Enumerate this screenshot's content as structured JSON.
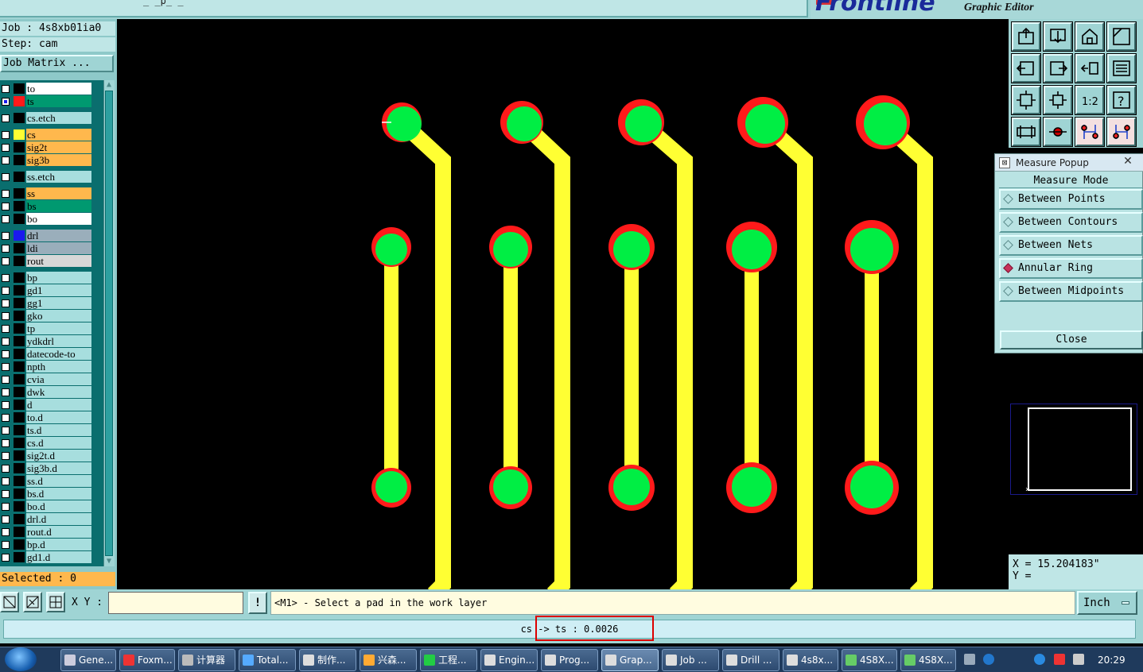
{
  "app": {
    "brand": "Frontline",
    "subtitle": "Graphic Editor",
    "title_fragment": "_ _p_ _"
  },
  "left_panel": {
    "job_line": "Job : 4s8xb01ia0",
    "step_line": "Step: cam",
    "job_matrix_label": "Job Matrix ...",
    "selected_label": "Selected : 0",
    "layers": [
      {
        "name": "to",
        "color": "#ffffff",
        "swatch": "#000000",
        "checked": false
      },
      {
        "name": "ts",
        "color": "#009970",
        "swatch": "#ff1a1a",
        "checked": true
      },
      {
        "name": "cs.etch",
        "color": "#a7dede",
        "swatch": "#000000",
        "checked": false
      },
      {
        "name": "cs",
        "color": "#ffb84d",
        "swatch": "#ffff33",
        "checked": false
      },
      {
        "name": "sig2t",
        "color": "#ffb84d",
        "swatch": "#000000",
        "checked": false
      },
      {
        "name": "sig3b",
        "color": "#ffb84d",
        "swatch": "#000000",
        "checked": false
      },
      {
        "name": "ss.etch",
        "color": "#a7dede",
        "swatch": "#000000",
        "checked": false
      },
      {
        "name": "ss",
        "color": "#ffb84d",
        "swatch": "#000000",
        "checked": false
      },
      {
        "name": "bs",
        "color": "#009970",
        "swatch": "#000000",
        "checked": false
      },
      {
        "name": "bo",
        "color": "#ffffff",
        "swatch": "#000000",
        "checked": false
      },
      {
        "name": "drl",
        "color": "#9aaebb",
        "swatch": "#1a1aee",
        "checked": false
      },
      {
        "name": "ldi",
        "color": "#9aaebb",
        "swatch": "#000000",
        "checked": false
      },
      {
        "name": "rout",
        "color": "#d8d8d8",
        "swatch": "#000000",
        "checked": false
      },
      {
        "name": "bp",
        "color": "#a7dede",
        "swatch": "#000000",
        "checked": false
      },
      {
        "name": "gd1",
        "color": "#a7dede",
        "swatch": "#000000",
        "checked": false
      },
      {
        "name": "gg1",
        "color": "#a7dede",
        "swatch": "#000000",
        "checked": false
      },
      {
        "name": "gko",
        "color": "#a7dede",
        "swatch": "#000000",
        "checked": false
      },
      {
        "name": "tp",
        "color": "#a7dede",
        "swatch": "#000000",
        "checked": false
      },
      {
        "name": "ydkdrl",
        "color": "#a7dede",
        "swatch": "#000000",
        "checked": false
      },
      {
        "name": "datecode-to",
        "color": "#a7dede",
        "swatch": "#000000",
        "checked": false
      },
      {
        "name": "npth",
        "color": "#a7dede",
        "swatch": "#000000",
        "checked": false
      },
      {
        "name": "cvia",
        "color": "#a7dede",
        "swatch": "#000000",
        "checked": false
      },
      {
        "name": "dwk",
        "color": "#a7dede",
        "swatch": "#000000",
        "checked": false
      },
      {
        "name": "d",
        "color": "#a7dede",
        "swatch": "#000000",
        "checked": false
      },
      {
        "name": "to.d",
        "color": "#a7dede",
        "swatch": "#000000",
        "checked": false
      },
      {
        "name": "ts.d",
        "color": "#a7dede",
        "swatch": "#000000",
        "checked": false
      },
      {
        "name": "cs.d",
        "color": "#a7dede",
        "swatch": "#000000",
        "checked": false
      },
      {
        "name": "sig2t.d",
        "color": "#a7dede",
        "swatch": "#000000",
        "checked": false
      },
      {
        "name": "sig3b.d",
        "color": "#a7dede",
        "swatch": "#000000",
        "checked": false
      },
      {
        "name": "ss.d",
        "color": "#a7dede",
        "swatch": "#000000",
        "checked": false
      },
      {
        "name": "bs.d",
        "color": "#a7dede",
        "swatch": "#000000",
        "checked": false
      },
      {
        "name": "bo.d",
        "color": "#a7dede",
        "swatch": "#000000",
        "checked": false
      },
      {
        "name": "drl.d",
        "color": "#a7dede",
        "swatch": "#000000",
        "checked": false
      },
      {
        "name": "rout.d",
        "color": "#a7dede",
        "swatch": "#000000",
        "checked": false
      },
      {
        "name": "bp.d",
        "color": "#a7dede",
        "swatch": "#000000",
        "checked": false
      },
      {
        "name": "gd1.d",
        "color": "#a7dede",
        "swatch": "#000000",
        "checked": false
      }
    ]
  },
  "toolbar": {
    "buttons": [
      "zoom-home-up-icon",
      "zoom-down-icon",
      "house-icon",
      "zoom-box-icon",
      "pan-left-icon",
      "pan-right-icon",
      "flip-icon",
      "snap-icon",
      "fit-all-icon",
      "fit-center-icon",
      "scale-1-2-icon",
      "help-icon",
      "tools-icon",
      "measure-probe-icon",
      "net-highlight-icon",
      "net-compare-icon"
    ],
    "scale_label": "1:2",
    "help_label": "?"
  },
  "measure_popup": {
    "title": "Measure Popup",
    "header": "Measure Mode",
    "options": [
      {
        "label": "Between Points",
        "selected": false
      },
      {
        "label": "Between Contours",
        "selected": false
      },
      {
        "label": "Between Nets",
        "selected": false
      },
      {
        "label": "Annular Ring",
        "selected": true
      },
      {
        "label": "Between Midpoints",
        "selected": false
      }
    ],
    "close_label": "Close"
  },
  "coords": {
    "x_line": "X = 15.204183\"",
    "y_line": "Y ="
  },
  "command_bar": {
    "xy_label": "X Y :",
    "xy_value": "",
    "info_label": "!",
    "prompt": "<M1> - Select a pad in the work layer",
    "unit_label": "Inch"
  },
  "status": {
    "text": "cs -> ts : 0.0026"
  },
  "colors": {
    "pad_ring": "#ff1a1a",
    "pad_center": "#00ee44",
    "trace": "#ffff33",
    "panel": "#9fd4d4"
  },
  "taskbar": {
    "items": [
      {
        "label": "Gene...",
        "icon": "#ccd"
      },
      {
        "label": "Foxm...",
        "icon": "#e33"
      },
      {
        "label": "计算器",
        "icon": "#bbb"
      },
      {
        "label": "Total...",
        "icon": "#5af"
      },
      {
        "label": "制作...",
        "icon": "#ddd"
      },
      {
        "label": "兴森...",
        "icon": "#fa3"
      },
      {
        "label": "工程...",
        "icon": "#2c4"
      },
      {
        "label": "Engin...",
        "icon": "#ddd"
      },
      {
        "label": "Prog...",
        "icon": "#ddd"
      },
      {
        "label": "Grap...",
        "icon": "#ddd",
        "active": true
      },
      {
        "label": "Job ...",
        "icon": "#ddd"
      },
      {
        "label": "Drill ...",
        "icon": "#ddd"
      },
      {
        "label": "4s8x...",
        "icon": "#ddd"
      },
      {
        "label": "4S8X...",
        "icon": "#6c6"
      },
      {
        "label": "4S8X...",
        "icon": "#6c6"
      }
    ],
    "time": "20:29"
  }
}
